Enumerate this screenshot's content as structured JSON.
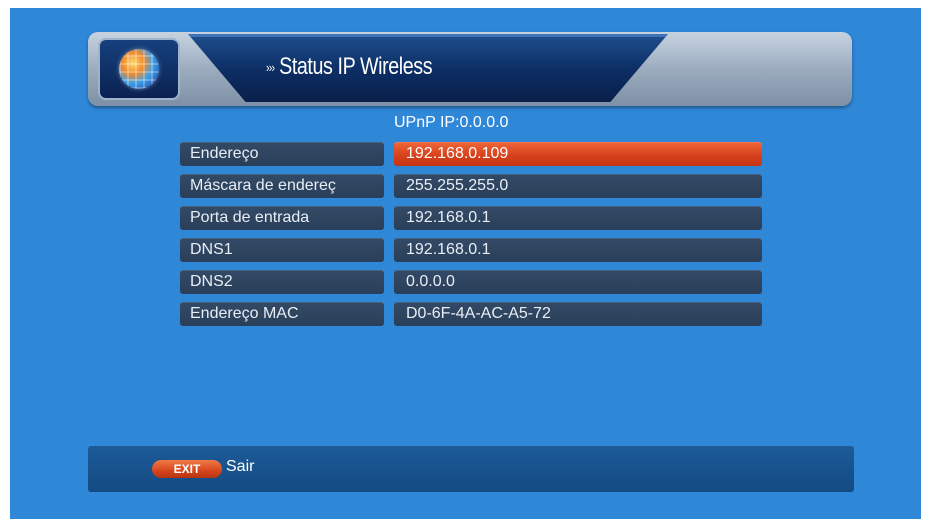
{
  "header": {
    "title": "Status IP Wireless",
    "arrows": "›››",
    "icon": "globe-icon"
  },
  "upnp": "UPnP IP:0.0.0.0",
  "rows": [
    {
      "label": "Endereço",
      "value": "192.168.0.109",
      "selected": true
    },
    {
      "label": "Máscara de endereç",
      "value": "255.255.255.0"
    },
    {
      "label": "Porta de entrada",
      "value": "192.168.0.1"
    },
    {
      "label": "DNS1",
      "value": "192.168.0.1"
    },
    {
      "label": "DNS2",
      "value": "0.0.0.0"
    },
    {
      "label": "Endereço MAC",
      "value": "D0-6F-4A-AC-A5-72"
    }
  ],
  "footer": {
    "exit_button": "EXIT",
    "exit_label": "Sair"
  },
  "colors": {
    "background": "#2f87d8",
    "highlight": "#d6421c",
    "field": "#2a3f59"
  }
}
